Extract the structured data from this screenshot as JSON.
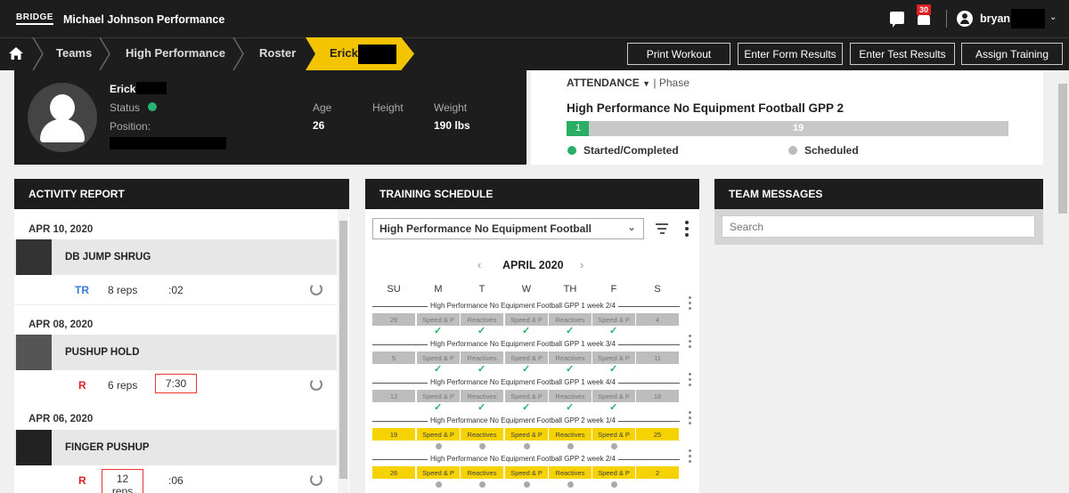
{
  "app": {
    "logo": "BRIDGE",
    "title": "Michael Johnson Performance",
    "notifications": "30",
    "user": "bryan"
  },
  "breadcrumb": [
    "Teams",
    "High Performance",
    "Roster"
  ],
  "breadcrumb_active": "Erick",
  "buttons": {
    "print": "Print Workout",
    "form": "Enter Form Results",
    "test": "Enter Test Results",
    "assign": "Assign Training"
  },
  "profile": {
    "name": "Erick",
    "status_label": "Status",
    "position_label": "Position:",
    "age_label": "Age",
    "age": "26",
    "height_label": "Height",
    "weight_label": "Weight",
    "weight": "190 lbs"
  },
  "attendance": {
    "title": "ATTENDANCE",
    "phase": "| Phase",
    "program": "High Performance No Equipment Football GPP 2",
    "completed": "1",
    "scheduled_count": "19",
    "completed_fraction": 0.05,
    "legend_completed": "Started/Completed",
    "legend_scheduled": "Scheduled",
    "color_completed": "#2aae66"
  },
  "activity": {
    "title": "ACTIVITY REPORT",
    "entries": [
      {
        "date": "APR 10, 2020",
        "exercise": "DB JUMP SHRUG",
        "code": "TR",
        "code_color": "#3a7ad8",
        "reps": "8 reps",
        "time": ":02"
      },
      {
        "date": "APR 08, 2020",
        "exercise": "PUSHUP HOLD",
        "code": "R",
        "code_color": "#d22",
        "reps": "6 reps",
        "time": "7:30"
      },
      {
        "date": "APR 06, 2020",
        "exercise": "FINGER PUSHUP",
        "code": "R",
        "code_color": "#d22",
        "reps": "12 reps",
        "time": ":06"
      }
    ]
  },
  "schedule": {
    "title": "TRAINING SCHEDULE",
    "program_select": "High Performance No Equipment Football",
    "month": "APRIL 2020",
    "days": [
      "SU",
      "M",
      "T",
      "W",
      "TH",
      "F",
      "S"
    ],
    "weeks": [
      {
        "label": "High Performance No Equipment Football GPP 1 week 2/4",
        "cells": [
          "29",
          "Speed & P",
          "Reactives",
          "Speed & P",
          "Reactives",
          "Speed & P",
          "4"
        ],
        "highlight": false,
        "done": true
      },
      {
        "label": "High Performance No Equipment Football GPP 1 week 3/4",
        "cells": [
          "5",
          "Speed & P",
          "Reactives",
          "Speed & P",
          "Reactives",
          "Speed & P",
          "11"
        ],
        "highlight": false,
        "done": true
      },
      {
        "label": "High Performance No Equipment Football GPP 1 week 4/4",
        "cells": [
          "12",
          "Speed & P",
          "Reactives",
          "Speed & P",
          "Reactives",
          "Speed & P",
          "18"
        ],
        "highlight": false,
        "done": true
      },
      {
        "label": "High Performance No Equipment Football GPP 2 week 1/4",
        "cells": [
          "19",
          "Speed & P",
          "Reactives",
          "Speed & P",
          "Reactives",
          "Speed & P",
          "25"
        ],
        "highlight": true,
        "done": false
      },
      {
        "label": "High Performance No Equipment Football GPP 2 week 2/4",
        "cells": [
          "26",
          "Speed & P",
          "Reactives",
          "Speed & P",
          "Reactives",
          "Speed & P",
          "2"
        ],
        "highlight": true,
        "done": false
      }
    ]
  },
  "messages": {
    "title": "TEAM MESSAGES",
    "search_placeholder": "Search"
  }
}
